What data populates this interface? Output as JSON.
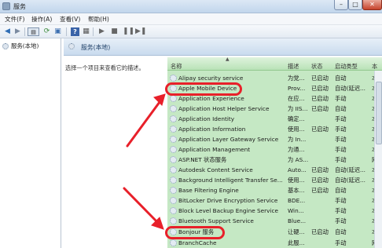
{
  "window": {
    "title": "服务"
  },
  "menu": [
    {
      "label": "文件(F)"
    },
    {
      "label": "操作(A)"
    },
    {
      "label": "查看(V)"
    },
    {
      "label": "帮助(H)"
    }
  ],
  "toolbar": [
    "back-icon",
    "forward-icon",
    "show-tree-icon",
    "refresh-icon",
    "export-icon",
    "help-icon",
    "properties-icon",
    "start-icon",
    "stop-icon",
    "pause-icon",
    "restart-icon"
  ],
  "tree": {
    "item": "服务(本地)"
  },
  "pane": {
    "title": "服务(本地)",
    "description": "选择一个项目来查看它的描述。"
  },
  "table": {
    "columns": [
      "名称",
      "描述",
      "状态",
      "启动类型",
      "本"
    ],
    "rows": [
      {
        "name": "Alipay security service",
        "desc": "为党...",
        "status": "已启动",
        "startup": "自动",
        "logon": "本"
      },
      {
        "name": "Apple Mobile Device",
        "desc": "Prov...",
        "status": "已启动",
        "startup": "自动(延迟...",
        "logon": "本"
      },
      {
        "name": "Application Experience",
        "desc": "在应...",
        "status": "已启动",
        "startup": "手动",
        "logon": "本"
      },
      {
        "name": "Application Host Helper Service",
        "desc": "为 IIS...",
        "status": "已启动",
        "startup": "自动",
        "logon": "本"
      },
      {
        "name": "Application Identity",
        "desc": "确定...",
        "status": "",
        "startup": "手动",
        "logon": "本"
      },
      {
        "name": "Application Information",
        "desc": "使用...",
        "status": "已启动",
        "startup": "手动",
        "logon": "本"
      },
      {
        "name": "Application Layer Gateway Service",
        "desc": "为 In...",
        "status": "",
        "startup": "手动",
        "logon": "本"
      },
      {
        "name": "Application Management",
        "desc": "为通...",
        "status": "",
        "startup": "手动",
        "logon": "本"
      },
      {
        "name": "ASP.NET 状态服务",
        "desc": "为 AS...",
        "status": "",
        "startup": "手动",
        "logon": "网"
      },
      {
        "name": "Autodesk Content Service",
        "desc": "Auto...",
        "status": "已启动",
        "startup": "自动(延迟...",
        "logon": "本"
      },
      {
        "name": "Background Intelligent Transfer Se...",
        "desc": "使用...",
        "status": "已启动",
        "startup": "自动(延迟...",
        "logon": "本"
      },
      {
        "name": "Base Filtering Engine",
        "desc": "基本...",
        "status": "已启动",
        "startup": "自动",
        "logon": "本"
      },
      {
        "name": "BitLocker Drive Encryption Service",
        "desc": "BDE...",
        "status": "",
        "startup": "手动",
        "logon": "本"
      },
      {
        "name": "Block Level Backup Engine Service",
        "desc": "Win...",
        "status": "",
        "startup": "手动",
        "logon": "本"
      },
      {
        "name": "Bluetooth Support Service",
        "desc": "Blue...",
        "status": "",
        "startup": "手动",
        "logon": "本"
      },
      {
        "name": "Bonjour 服务",
        "desc": "让硬...",
        "status": "已启动",
        "startup": "自动",
        "logon": "本"
      },
      {
        "name": "BranchCache",
        "desc": "此服...",
        "status": "",
        "startup": "手动",
        "logon": "网"
      }
    ]
  }
}
